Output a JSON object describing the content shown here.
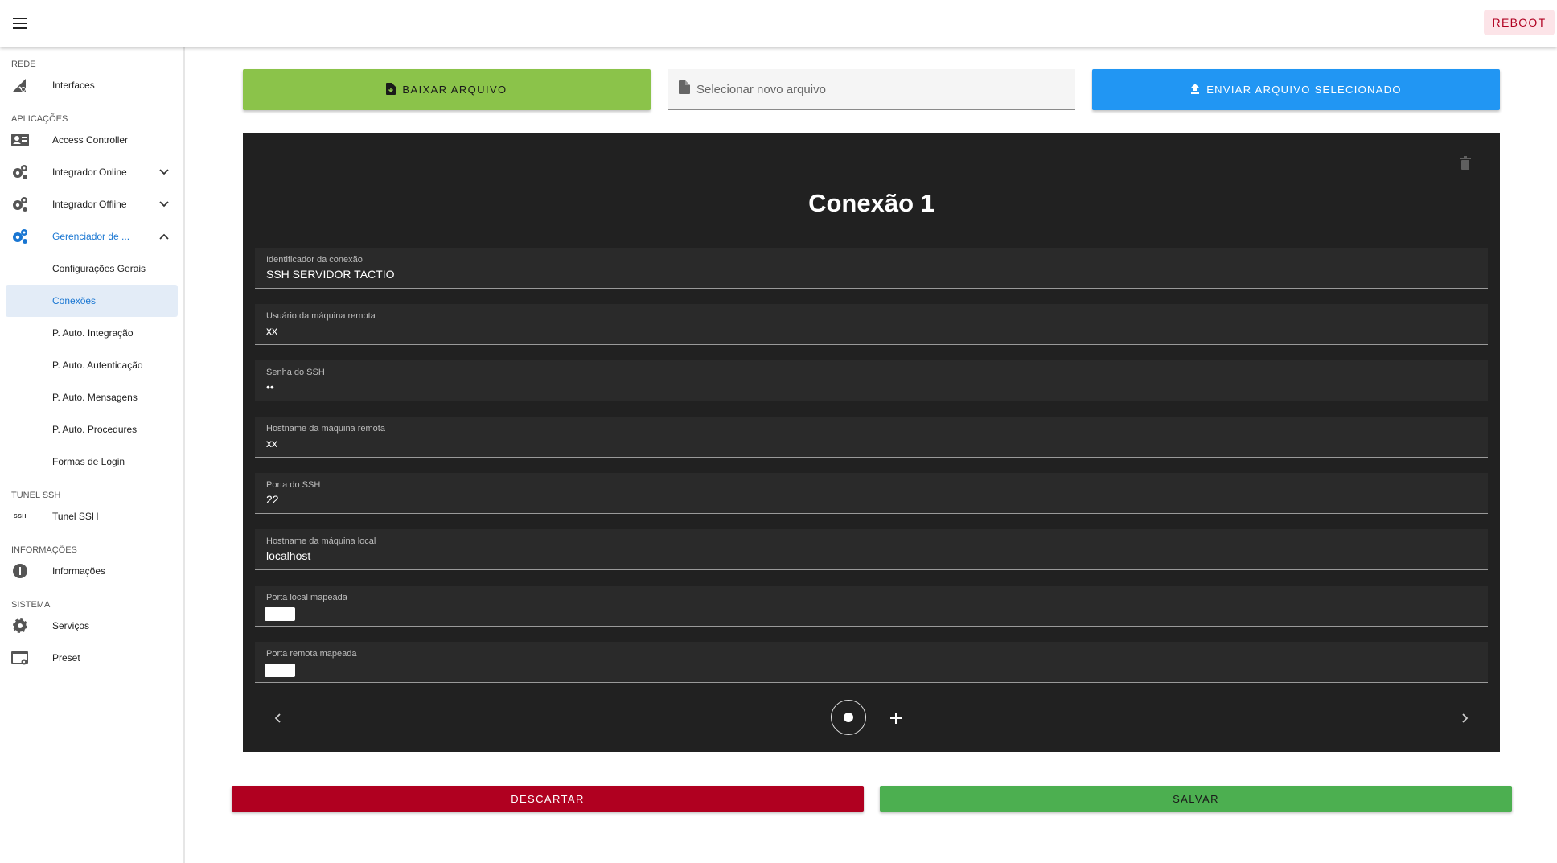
{
  "topbar": {
    "menu_icon": "hamburger-menu-icon",
    "reboot_label": "REBOOT"
  },
  "sidebar": {
    "sections": {
      "rede": "REDE",
      "aplicacoes": "APLICAÇÕES",
      "tunel_ssh": "TUNEL SSH",
      "informacoes": "INFORMAÇÕES",
      "sistema": "SISTEMA"
    },
    "items": {
      "interfaces": "Interfaces",
      "access_controller": "Access Controller",
      "integrador_online": "Integrador Online",
      "integrador_offline": "Integrador Offline",
      "gerenciador": "Gerenciador de ...",
      "tunel_ssh": "Tunel SSH",
      "ssh_icon_text": "SSH",
      "informacoes": "Informações",
      "servicos": "Serviços",
      "preset": "Preset"
    },
    "subitems": [
      "Configurações Gerais",
      "Conexões",
      "P. Auto. Integração",
      "P. Auto. Autenticação",
      "P. Auto. Mensagens",
      "P. Auto. Procedures",
      "Formas de Login"
    ],
    "selected_subitem": "Conexões",
    "colors": {
      "active": "#1976d2",
      "selected_bg": "#e3ecf7"
    }
  },
  "actions": {
    "download_label": "BAIXAR ARQUIVO",
    "file_placeholder": "Selecionar novo arquivo",
    "upload_label": "ENVIAR ARQUIVO SELECIONADO",
    "discard_label": "DESCARTAR",
    "save_label": "SALVAR"
  },
  "card": {
    "title": "Conexão 1",
    "fields": [
      {
        "label": "Identificador da conexão",
        "value": "SSH SERVIDOR TACTIO"
      },
      {
        "label": "Usuário da máquina remota",
        "value": "xx"
      },
      {
        "label": "Senha do SSH",
        "value": "••"
      },
      {
        "label": "Hostname da máquina remota",
        "value": "xx"
      },
      {
        "label": "Porta do SSH",
        "value": "22"
      },
      {
        "label": "Hostname da máquina local",
        "value": "localhost"
      },
      {
        "label": "Porta local mapeada",
        "value": ""
      },
      {
        "label": "Porta remota mapeada",
        "value": ""
      }
    ]
  },
  "colors": {
    "download": "#8bc34a",
    "upload": "#2196f3",
    "discard": "#b00020",
    "save": "#4caf50",
    "card_bg": "#212121"
  }
}
